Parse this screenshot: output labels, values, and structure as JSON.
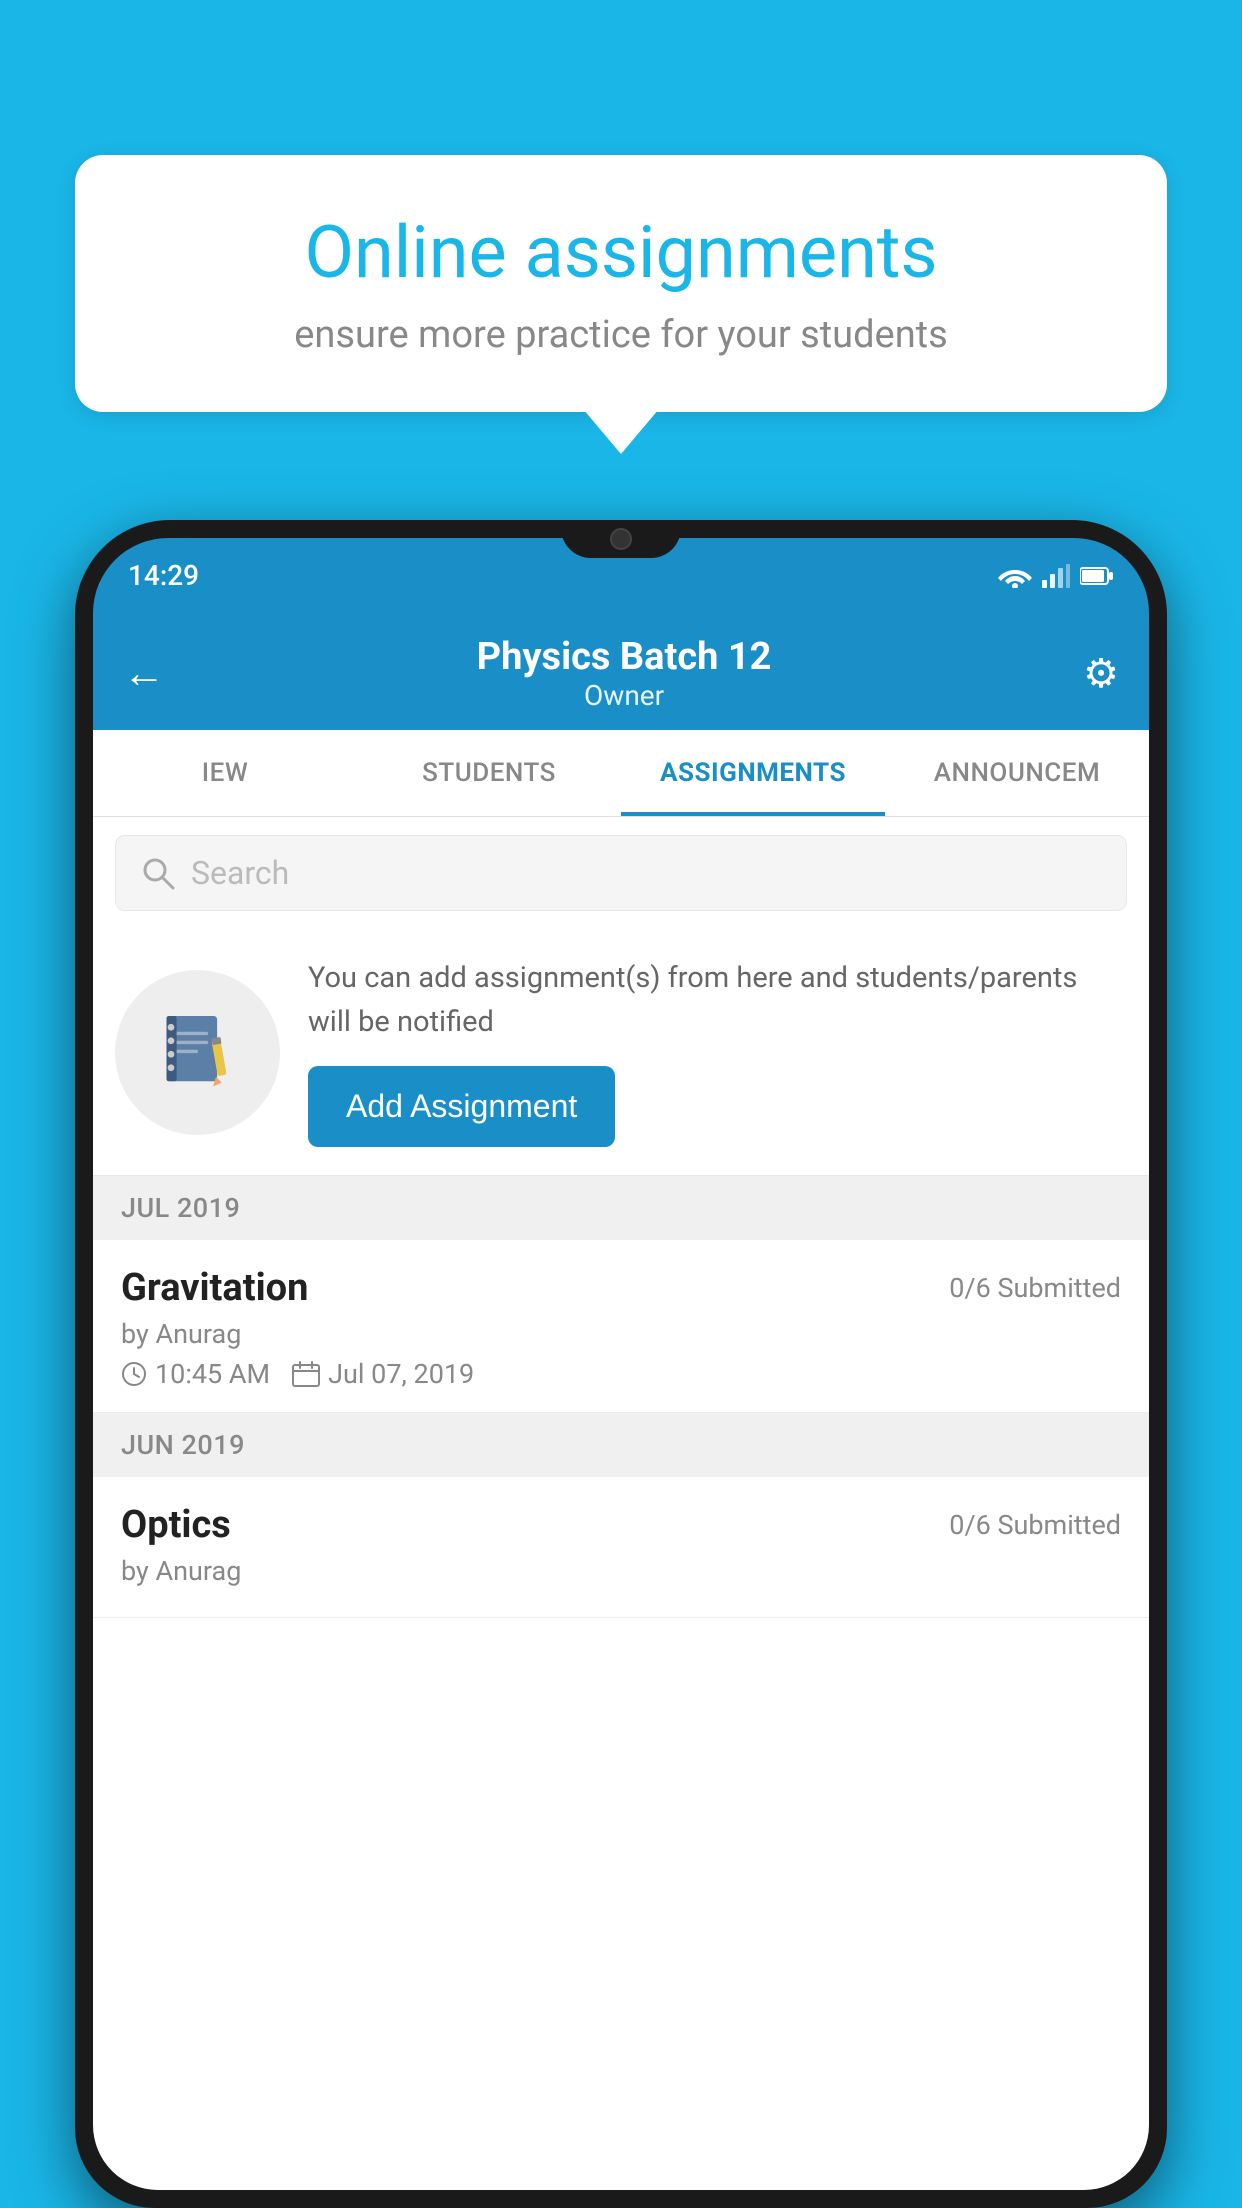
{
  "background_color": "#1ab6e8",
  "bubble": {
    "title": "Online assignments",
    "subtitle": "ensure more practice for your students"
  },
  "status_bar": {
    "time": "14:29",
    "wifi": "wifi",
    "signal": "signal",
    "battery": "battery"
  },
  "header": {
    "title": "Physics Batch 12",
    "subtitle": "Owner",
    "back_label": "←",
    "gear_label": "⚙"
  },
  "tabs": [
    {
      "label": "IEW",
      "active": false
    },
    {
      "label": "STUDENTS",
      "active": false
    },
    {
      "label": "ASSIGNMENTS",
      "active": true
    },
    {
      "label": "ANNOUNCEM",
      "active": false
    }
  ],
  "search": {
    "placeholder": "Search"
  },
  "info_card": {
    "description": "You can add assignment(s) from here and students/parents will be notified",
    "button_label": "Add Assignment"
  },
  "sections": [
    {
      "month": "JUL 2019",
      "assignments": [
        {
          "title": "Gravitation",
          "submitted": "0/6 Submitted",
          "by": "by Anurag",
          "time": "10:45 AM",
          "date": "Jul 07, 2019"
        }
      ]
    },
    {
      "month": "JUN 2019",
      "assignments": [
        {
          "title": "Optics",
          "submitted": "0/6 Submitted",
          "by": "by Anurag",
          "time": "",
          "date": ""
        }
      ]
    }
  ]
}
